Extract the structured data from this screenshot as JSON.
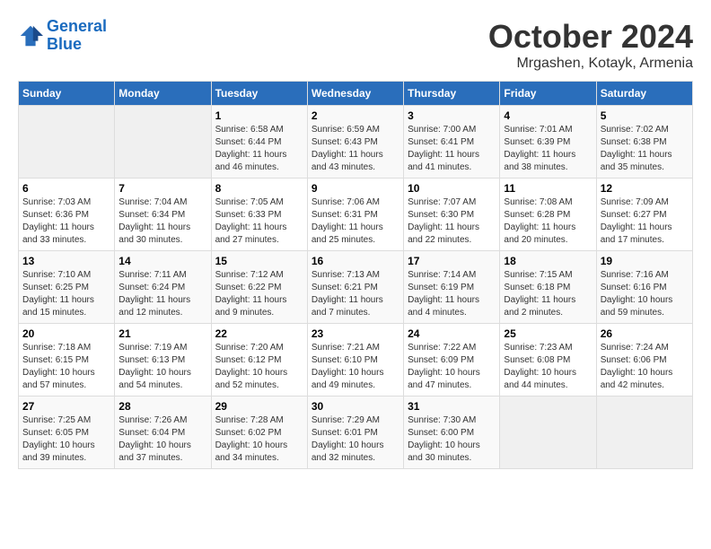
{
  "header": {
    "logo_line1": "General",
    "logo_line2": "Blue",
    "month": "October 2024",
    "location": "Mrgashen, Kotayk, Armenia"
  },
  "weekdays": [
    "Sunday",
    "Monday",
    "Tuesday",
    "Wednesday",
    "Thursday",
    "Friday",
    "Saturday"
  ],
  "weeks": [
    [
      {
        "day": "",
        "sunrise": "",
        "sunset": "",
        "daylight": ""
      },
      {
        "day": "",
        "sunrise": "",
        "sunset": "",
        "daylight": ""
      },
      {
        "day": "1",
        "sunrise": "Sunrise: 6:58 AM",
        "sunset": "Sunset: 6:44 PM",
        "daylight": "Daylight: 11 hours and 46 minutes."
      },
      {
        "day": "2",
        "sunrise": "Sunrise: 6:59 AM",
        "sunset": "Sunset: 6:43 PM",
        "daylight": "Daylight: 11 hours and 43 minutes."
      },
      {
        "day": "3",
        "sunrise": "Sunrise: 7:00 AM",
        "sunset": "Sunset: 6:41 PM",
        "daylight": "Daylight: 11 hours and 41 minutes."
      },
      {
        "day": "4",
        "sunrise": "Sunrise: 7:01 AM",
        "sunset": "Sunset: 6:39 PM",
        "daylight": "Daylight: 11 hours and 38 minutes."
      },
      {
        "day": "5",
        "sunrise": "Sunrise: 7:02 AM",
        "sunset": "Sunset: 6:38 PM",
        "daylight": "Daylight: 11 hours and 35 minutes."
      }
    ],
    [
      {
        "day": "6",
        "sunrise": "Sunrise: 7:03 AM",
        "sunset": "Sunset: 6:36 PM",
        "daylight": "Daylight: 11 hours and 33 minutes."
      },
      {
        "day": "7",
        "sunrise": "Sunrise: 7:04 AM",
        "sunset": "Sunset: 6:34 PM",
        "daylight": "Daylight: 11 hours and 30 minutes."
      },
      {
        "day": "8",
        "sunrise": "Sunrise: 7:05 AM",
        "sunset": "Sunset: 6:33 PM",
        "daylight": "Daylight: 11 hours and 27 minutes."
      },
      {
        "day": "9",
        "sunrise": "Sunrise: 7:06 AM",
        "sunset": "Sunset: 6:31 PM",
        "daylight": "Daylight: 11 hours and 25 minutes."
      },
      {
        "day": "10",
        "sunrise": "Sunrise: 7:07 AM",
        "sunset": "Sunset: 6:30 PM",
        "daylight": "Daylight: 11 hours and 22 minutes."
      },
      {
        "day": "11",
        "sunrise": "Sunrise: 7:08 AM",
        "sunset": "Sunset: 6:28 PM",
        "daylight": "Daylight: 11 hours and 20 minutes."
      },
      {
        "day": "12",
        "sunrise": "Sunrise: 7:09 AM",
        "sunset": "Sunset: 6:27 PM",
        "daylight": "Daylight: 11 hours and 17 minutes."
      }
    ],
    [
      {
        "day": "13",
        "sunrise": "Sunrise: 7:10 AM",
        "sunset": "Sunset: 6:25 PM",
        "daylight": "Daylight: 11 hours and 15 minutes."
      },
      {
        "day": "14",
        "sunrise": "Sunrise: 7:11 AM",
        "sunset": "Sunset: 6:24 PM",
        "daylight": "Daylight: 11 hours and 12 minutes."
      },
      {
        "day": "15",
        "sunrise": "Sunrise: 7:12 AM",
        "sunset": "Sunset: 6:22 PM",
        "daylight": "Daylight: 11 hours and 9 minutes."
      },
      {
        "day": "16",
        "sunrise": "Sunrise: 7:13 AM",
        "sunset": "Sunset: 6:21 PM",
        "daylight": "Daylight: 11 hours and 7 minutes."
      },
      {
        "day": "17",
        "sunrise": "Sunrise: 7:14 AM",
        "sunset": "Sunset: 6:19 PM",
        "daylight": "Daylight: 11 hours and 4 minutes."
      },
      {
        "day": "18",
        "sunrise": "Sunrise: 7:15 AM",
        "sunset": "Sunset: 6:18 PM",
        "daylight": "Daylight: 11 hours and 2 minutes."
      },
      {
        "day": "19",
        "sunrise": "Sunrise: 7:16 AM",
        "sunset": "Sunset: 6:16 PM",
        "daylight": "Daylight: 10 hours and 59 minutes."
      }
    ],
    [
      {
        "day": "20",
        "sunrise": "Sunrise: 7:18 AM",
        "sunset": "Sunset: 6:15 PM",
        "daylight": "Daylight: 10 hours and 57 minutes."
      },
      {
        "day": "21",
        "sunrise": "Sunrise: 7:19 AM",
        "sunset": "Sunset: 6:13 PM",
        "daylight": "Daylight: 10 hours and 54 minutes."
      },
      {
        "day": "22",
        "sunrise": "Sunrise: 7:20 AM",
        "sunset": "Sunset: 6:12 PM",
        "daylight": "Daylight: 10 hours and 52 minutes."
      },
      {
        "day": "23",
        "sunrise": "Sunrise: 7:21 AM",
        "sunset": "Sunset: 6:10 PM",
        "daylight": "Daylight: 10 hours and 49 minutes."
      },
      {
        "day": "24",
        "sunrise": "Sunrise: 7:22 AM",
        "sunset": "Sunset: 6:09 PM",
        "daylight": "Daylight: 10 hours and 47 minutes."
      },
      {
        "day": "25",
        "sunrise": "Sunrise: 7:23 AM",
        "sunset": "Sunset: 6:08 PM",
        "daylight": "Daylight: 10 hours and 44 minutes."
      },
      {
        "day": "26",
        "sunrise": "Sunrise: 7:24 AM",
        "sunset": "Sunset: 6:06 PM",
        "daylight": "Daylight: 10 hours and 42 minutes."
      }
    ],
    [
      {
        "day": "27",
        "sunrise": "Sunrise: 7:25 AM",
        "sunset": "Sunset: 6:05 PM",
        "daylight": "Daylight: 10 hours and 39 minutes."
      },
      {
        "day": "28",
        "sunrise": "Sunrise: 7:26 AM",
        "sunset": "Sunset: 6:04 PM",
        "daylight": "Daylight: 10 hours and 37 minutes."
      },
      {
        "day": "29",
        "sunrise": "Sunrise: 7:28 AM",
        "sunset": "Sunset: 6:02 PM",
        "daylight": "Daylight: 10 hours and 34 minutes."
      },
      {
        "day": "30",
        "sunrise": "Sunrise: 7:29 AM",
        "sunset": "Sunset: 6:01 PM",
        "daylight": "Daylight: 10 hours and 32 minutes."
      },
      {
        "day": "31",
        "sunrise": "Sunrise: 7:30 AM",
        "sunset": "Sunset: 6:00 PM",
        "daylight": "Daylight: 10 hours and 30 minutes."
      },
      {
        "day": "",
        "sunrise": "",
        "sunset": "",
        "daylight": ""
      },
      {
        "day": "",
        "sunrise": "",
        "sunset": "",
        "daylight": ""
      }
    ]
  ]
}
